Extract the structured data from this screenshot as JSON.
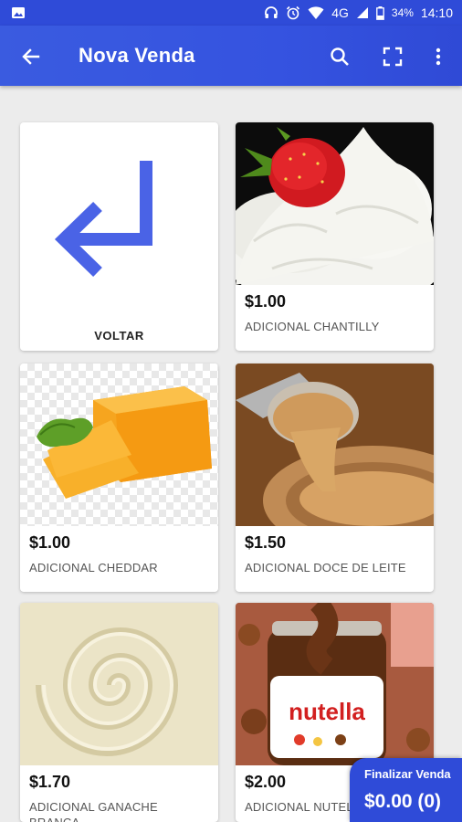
{
  "status_bar": {
    "network": "4G",
    "battery": "34%",
    "time": "14:10"
  },
  "app_bar": {
    "title": "Nova Venda",
    "icons": [
      "arrow-back-icon",
      "search-icon",
      "fullscreen-icon",
      "more-vert-icon"
    ]
  },
  "back_tile": {
    "label": "VOLTAR"
  },
  "products": [
    {
      "price": "$1.00",
      "name": "ADICIONAL CHANTILLY",
      "image": "whipped-cream-strawberry"
    },
    {
      "price": "$1.00",
      "name": "ADICIONAL CHEDDAR",
      "image": "cheddar-cheese"
    },
    {
      "price": "$1.50",
      "name": "ADICIONAL DOCE DE LEITE",
      "image": "doce-de-leite-spoon"
    },
    {
      "price": "$1.70",
      "name": "ADICIONAL GANACHE BRANCA",
      "image": "white-ganache-swirl"
    },
    {
      "price": "$2.00",
      "name": "ADICIONAL NUTELLA",
      "image": "nutella-jar"
    }
  ],
  "nutella_label": "nutella",
  "fab": {
    "label": "Finalizar Venda",
    "total": "$0.00 (0)"
  },
  "colors": {
    "primary": "#2f4bd8",
    "accent_arrow": "#4a63e6"
  }
}
